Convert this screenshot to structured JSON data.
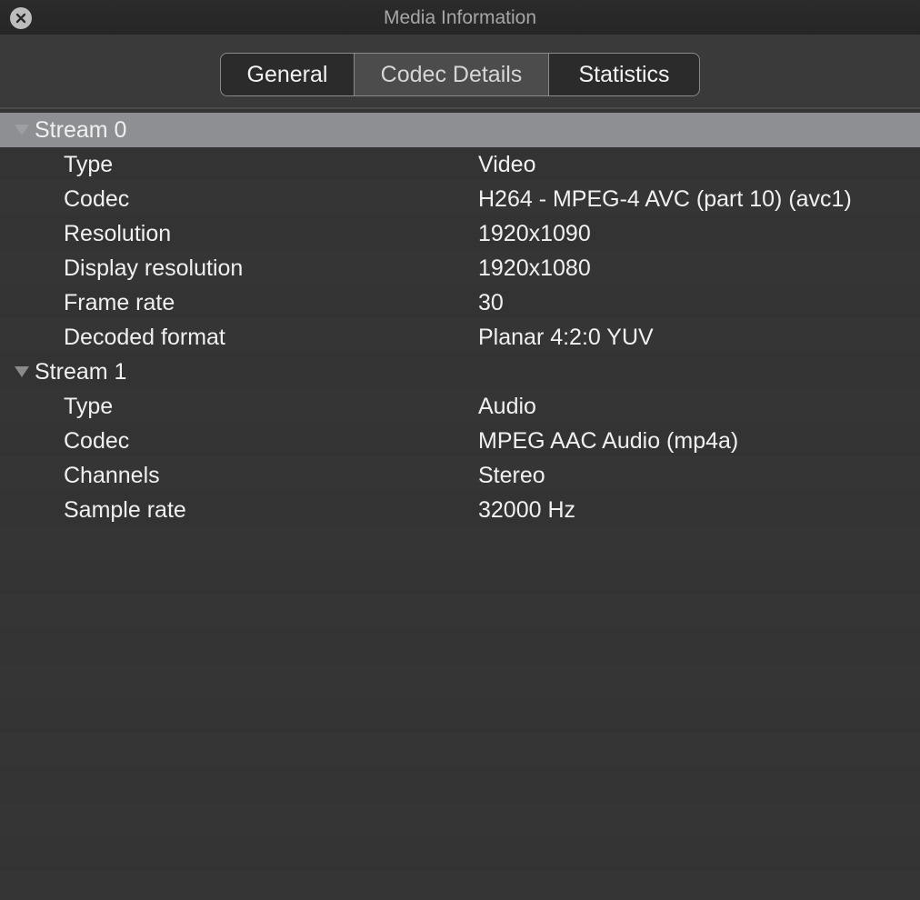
{
  "window": {
    "title": "Media Information"
  },
  "tabs": [
    {
      "label": "General"
    },
    {
      "label": "Codec Details"
    },
    {
      "label": "Statistics"
    }
  ],
  "selected_tab": "Codec Details",
  "streams": [
    {
      "label": "Stream 0",
      "properties": [
        {
          "key": "Type",
          "value": "Video"
        },
        {
          "key": "Codec",
          "value": "H264 - MPEG-4 AVC (part 10) (avc1)"
        },
        {
          "key": "Resolution",
          "value": "1920x1090"
        },
        {
          "key": "Display resolution",
          "value": "1920x1080"
        },
        {
          "key": "Frame rate",
          "value": "30"
        },
        {
          "key": "Decoded format",
          "value": "Planar 4:2:0 YUV"
        }
      ]
    },
    {
      "label": "Stream 1",
      "properties": [
        {
          "key": "Type",
          "value": "Audio"
        },
        {
          "key": "Codec",
          "value": "MPEG AAC Audio (mp4a)"
        },
        {
          "key": "Channels",
          "value": "Stereo"
        },
        {
          "key": "Sample rate",
          "value": "32000 Hz"
        }
      ]
    }
  ],
  "icons": {
    "close": "close-icon",
    "disclosure": "disclosure-triangle-icon"
  },
  "colors": {
    "selected_row": "#8e8f93",
    "background": "#353535"
  }
}
